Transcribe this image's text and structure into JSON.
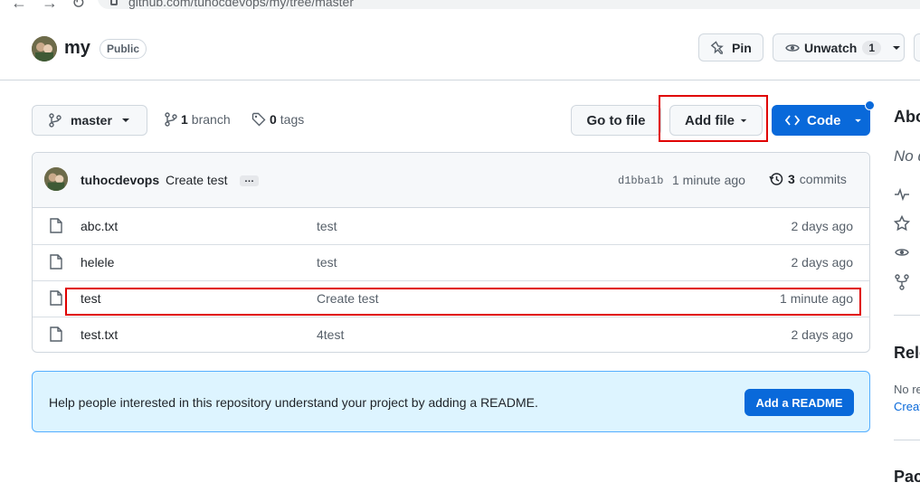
{
  "browser": {
    "url": "github.com/tuhocdevops/my/tree/master",
    "back_glyph": "←",
    "forward_glyph": "→",
    "reload_glyph": "↻"
  },
  "repo": {
    "name": "my",
    "visibility": "Public",
    "pin_label": "Pin",
    "unwatch_label": "Unwatch",
    "watch_count": "1"
  },
  "toolbar": {
    "branch_name": "master",
    "branch_count": "1",
    "branch_label": "branch",
    "tag_count": "0",
    "tag_label": "tags",
    "go_to_file": "Go to file",
    "add_file": "Add file",
    "code": "Code"
  },
  "commit": {
    "author": "tuhocdevops",
    "message": "Create test",
    "ellipsis": "…",
    "sha": "d1bba1b",
    "time": "1 minute ago",
    "commit_count": "3",
    "commit_label": "commits"
  },
  "files": [
    {
      "name": "abc.txt",
      "message": "test",
      "age": "2 days ago"
    },
    {
      "name": "helele",
      "message": "test",
      "age": "2 days ago"
    },
    {
      "name": "test",
      "message": "Create test",
      "age": "1 minute ago"
    },
    {
      "name": "test.txt",
      "message": "4test",
      "age": "2 days ago"
    }
  ],
  "readme": {
    "text": "Help people interested in this repository understand your project by adding a README.",
    "button": "Add a README"
  },
  "sidebar": {
    "about_title": "Abo",
    "about_text": "No d",
    "releases_title": "Rele",
    "releases_text_1": "No re",
    "releases_link": "Creat",
    "packages_title": "Pac"
  },
  "colors": {
    "accent": "#0969da",
    "highlight": "#e00000",
    "readme_bg": "#ddf4ff"
  }
}
